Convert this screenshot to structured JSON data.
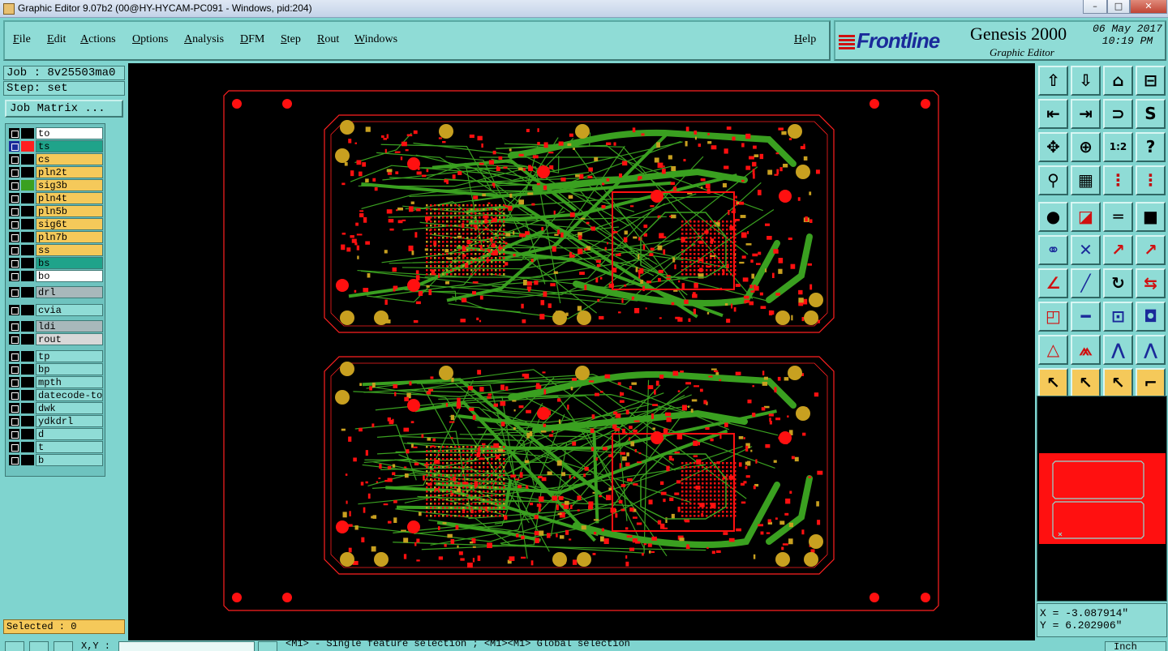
{
  "window": {
    "title": "Graphic Editor 9.07b2 (00@HY-HYCAM-PC091 - Windows, pid:204)",
    "controls": [
      "minimize-icon",
      "maximize-icon",
      "close-icon"
    ]
  },
  "menu": {
    "file": "File",
    "edit": "Edit",
    "actions": "Actions",
    "options": "Options",
    "analysis": "Analysis",
    "dfm": "DFM",
    "step": "Step",
    "rout": "Rout",
    "windows": "Windows",
    "help": "Help"
  },
  "logo": {
    "brand": "Frontline",
    "product": "Genesis 2000",
    "subtitle": "Graphic Editor",
    "date": "06 May 2017",
    "time": "10:19 PM"
  },
  "left": {
    "job": "Job : 8v25503ma0",
    "step": "Step: set",
    "job_matrix": "Job Matrix ..."
  },
  "layers": [
    {
      "name": "to",
      "color": "#ffffff",
      "swatch": "#000000"
    },
    {
      "name": "ts",
      "color": "#1fa38a",
      "swatch": "#ff2020",
      "active": true
    },
    {
      "name": "cs",
      "color": "#f5c95a",
      "swatch": "#000000"
    },
    {
      "name": "pln2t",
      "color": "#f5c95a",
      "swatch": "#000000"
    },
    {
      "name": "sig3b",
      "color": "#f5c95a",
      "swatch": "#3aa020"
    },
    {
      "name": "pln4t",
      "color": "#f5c95a",
      "swatch": "#000000"
    },
    {
      "name": "pln5b",
      "color": "#f5c95a",
      "swatch": "#000000"
    },
    {
      "name": "sig6t",
      "color": "#f5c95a",
      "swatch": "#000000"
    },
    {
      "name": "pln7b",
      "color": "#f5c95a",
      "swatch": "#000000"
    },
    {
      "name": "ss",
      "color": "#f5c95a",
      "swatch": "#000000"
    },
    {
      "name": "bs",
      "color": "#1fa38a",
      "swatch": "#000000"
    },
    {
      "name": "bo",
      "color": "#ffffff",
      "swatch": "#000000"
    },
    {
      "name": "drl",
      "color": "#a8b8bb",
      "swatch": "#000000"
    },
    {
      "name": "cvia",
      "color": "#8fdcd6",
      "swatch": "#000000"
    },
    {
      "name": "ldi",
      "color": "#a8b8bb",
      "swatch": "#000000"
    },
    {
      "name": "rout",
      "color": "#d8d8d8",
      "swatch": "#000000"
    },
    {
      "name": "tp",
      "color": "#8fdcd6",
      "swatch": "#000000"
    },
    {
      "name": "bp",
      "color": "#8fdcd6",
      "swatch": "#000000"
    },
    {
      "name": "mpth",
      "color": "#8fdcd6",
      "swatch": "#000000"
    },
    {
      "name": "datecode-to",
      "color": "#8fdcd6",
      "swatch": "#000000"
    },
    {
      "name": "dwk",
      "color": "#8fdcd6",
      "swatch": "#000000"
    },
    {
      "name": "ydkdrl",
      "color": "#8fdcd6",
      "swatch": "#000000"
    },
    {
      "name": "d",
      "color": "#8fdcd6",
      "swatch": "#000000"
    },
    {
      "name": "t",
      "color": "#8fdcd6",
      "swatch": "#000000"
    },
    {
      "name": "b",
      "color": "#8fdcd6",
      "swatch": "#000000"
    }
  ],
  "selected": "Selected : 0",
  "toolbar_icons": [
    "zoom-home-icon",
    "zoom-fit-icon",
    "zoom-profile-icon",
    "zoom-window-icon",
    "pan-left-icon",
    "pan-right-icon",
    "pan-swap-icon",
    "pan-step-icon",
    "zoom-in-icon",
    "zoom-out-icon",
    "one-to-one-icon",
    "query-icon",
    "snap-icon",
    "grid-icon",
    "layers-red-icon",
    "layers-red-alt-icon",
    "add-pad-icon",
    "add-line-icon",
    "measure-icon",
    "add-surface-icon",
    "connect-icon",
    "delete-node-icon",
    "move-node-icon",
    "slide-icon",
    "add-corner-icon",
    "edit-line-icon",
    "rotate-icon",
    "mirror-icon",
    "resize-icon",
    "break-icon",
    "fit-size-icon",
    "copy-pads-icon",
    "warn-triangle-icon",
    "warn-route-icon",
    "arc-icon",
    "arc-alt-icon",
    "select-pointer-icon",
    "select-box-icon",
    "select-touch-icon",
    "select-route-icon"
  ],
  "board_colors": {
    "background": "#000000",
    "copper_red": "#ff1010",
    "trace_green": "#3aa020",
    "pad_gold": "#c8a020",
    "outline": "#ff2020"
  },
  "coords": {
    "x": "X = -3.087914\"",
    "y": "Y = 6.202906\""
  },
  "status": {
    "xy_label": "X,Y :",
    "xy_value": "",
    "message": "<M1> - Single feature selection ; <M1><M1> Global selection",
    "unit": "Inch"
  }
}
